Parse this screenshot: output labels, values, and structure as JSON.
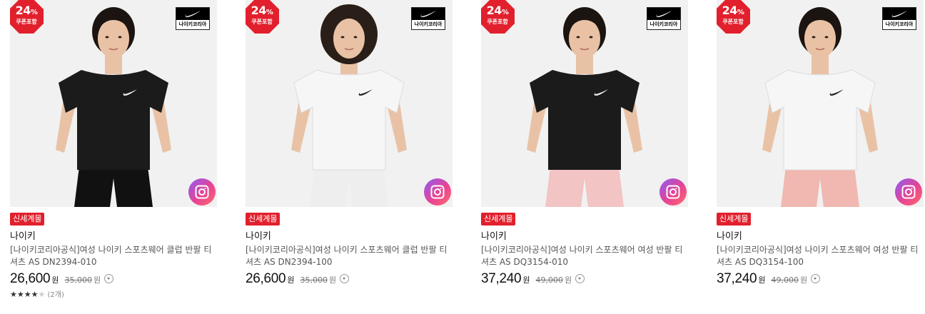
{
  "colors": {
    "coupon_badge": "#e2202d",
    "new_tag": "#e2202d",
    "price": "#111111",
    "snap_button": "#e84393"
  },
  "products": [
    {
      "discount_number": "24",
      "discount_unit": "%",
      "coupon_label": "쿠폰포함",
      "brand_logo_text": "나이키코리아",
      "tag": "신세계몰",
      "brand": "나이키",
      "title": "[나이키코리아공식]여성 나이키 스포츠웨어 클럽 반팔 티셔츠 AS DN2394-010",
      "price": "26,600",
      "price_unit": "원",
      "original_price": "35,000",
      "original_unit": "원",
      "rating_stars": 4,
      "review_count": "(2개)",
      "shirt_color": "#1b1b1b",
      "pants_color": "#111111",
      "pose": "hair-back"
    },
    {
      "discount_number": "24",
      "discount_unit": "%",
      "coupon_label": "쿠폰포함",
      "brand_logo_text": "나이키코리아",
      "tag": "신세계몰",
      "brand": "나이키",
      "title": "[나이키코리아공식]여성 나이키 스포츠웨어 클럽 반팔 티셔츠 AS DN2394-100",
      "price": "26,600",
      "price_unit": "원",
      "original_price": "35,000",
      "original_unit": "원",
      "shirt_color": "#f6f6f6",
      "pants_color": "#eeeeee",
      "pose": "curly"
    },
    {
      "discount_number": "24",
      "discount_unit": "%",
      "coupon_label": "쿠폰포함",
      "brand_logo_text": "나이키코리아",
      "tag": "신세계몰",
      "brand": "나이키",
      "title": "[나이키코리아공식]여성 나이키 스포츠웨어 여성 반팔 티셔츠 AS DQ3154-010",
      "price": "37,240",
      "price_unit": "원",
      "original_price": "49,000",
      "original_unit": "원",
      "shirt_color": "#1b1b1b",
      "pants_color": "#f2c4c4",
      "pose": "hair-back"
    },
    {
      "discount_number": "24",
      "discount_unit": "%",
      "coupon_label": "쿠폰포함",
      "brand_logo_text": "나이키코리아",
      "tag": "신세계몰",
      "brand": "나이키",
      "title": "[나이키코리아공식]여성 나이키 스포츠웨어 여성 반팔 티셔츠 AS DQ3154-100",
      "price": "37,240",
      "price_unit": "원",
      "original_price": "49,000",
      "original_unit": "원",
      "shirt_color": "#f6f6f6",
      "pants_color": "#f0b8b0",
      "pose": "ponytail"
    }
  ]
}
